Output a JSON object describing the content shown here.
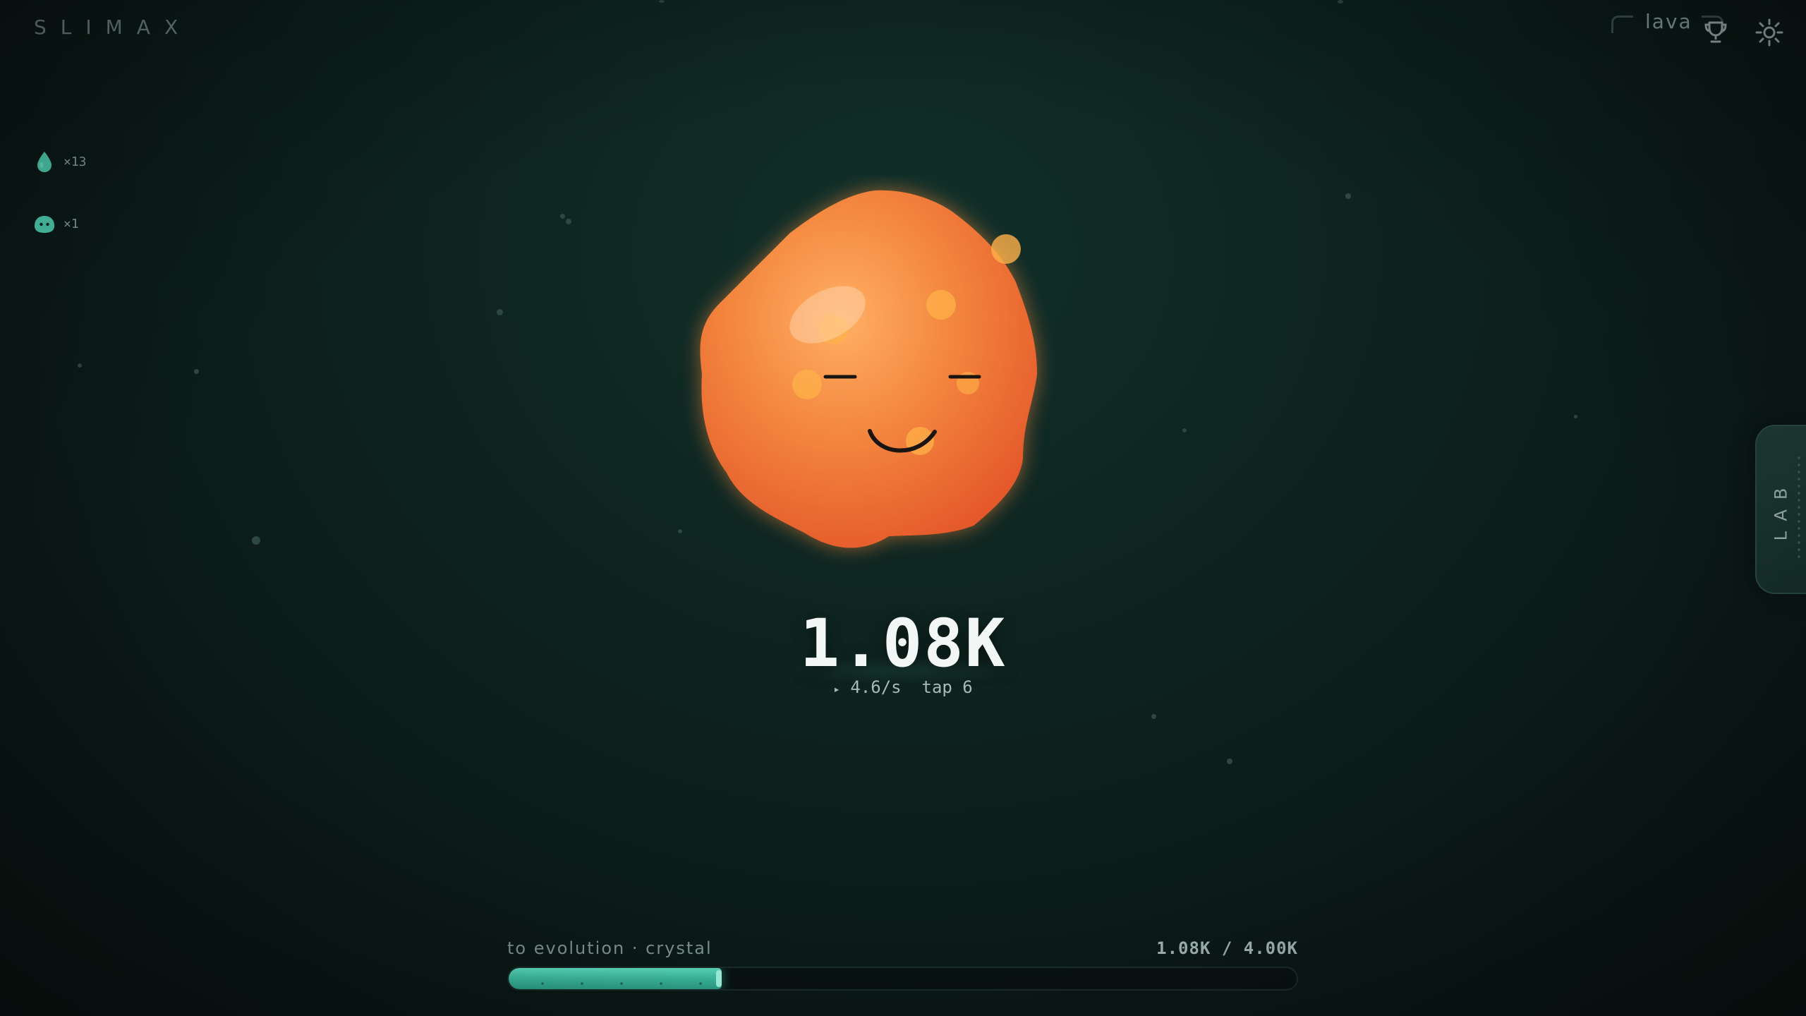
{
  "app": {
    "logo": "SLIMAX"
  },
  "header": {
    "current_form": "lava",
    "trophy_icon": "trophy-icon",
    "settings_icon": "sun-gear-icon"
  },
  "resources": [
    {
      "icon": "droplet-icon",
      "count": "×13"
    },
    {
      "icon": "slime-icon",
      "count": "×1"
    }
  ],
  "slime": {
    "type": "lava",
    "colors": {
      "body_light": "#ffb066",
      "body": "#f07a38",
      "body_dark": "#e4572a",
      "spots": "#ffb24a",
      "glow": "#ff9a3a"
    }
  },
  "score": {
    "value": "1.08K",
    "rate_arrow": "▸",
    "rate": "4.6/s",
    "tap": "tap 6"
  },
  "lab": {
    "label": "LAB"
  },
  "evolution": {
    "label": "to evolution · crystal",
    "progress_text": "1.08K / 4.00K",
    "progress_fraction": 0.27,
    "accent": "#4fd3b4"
  }
}
